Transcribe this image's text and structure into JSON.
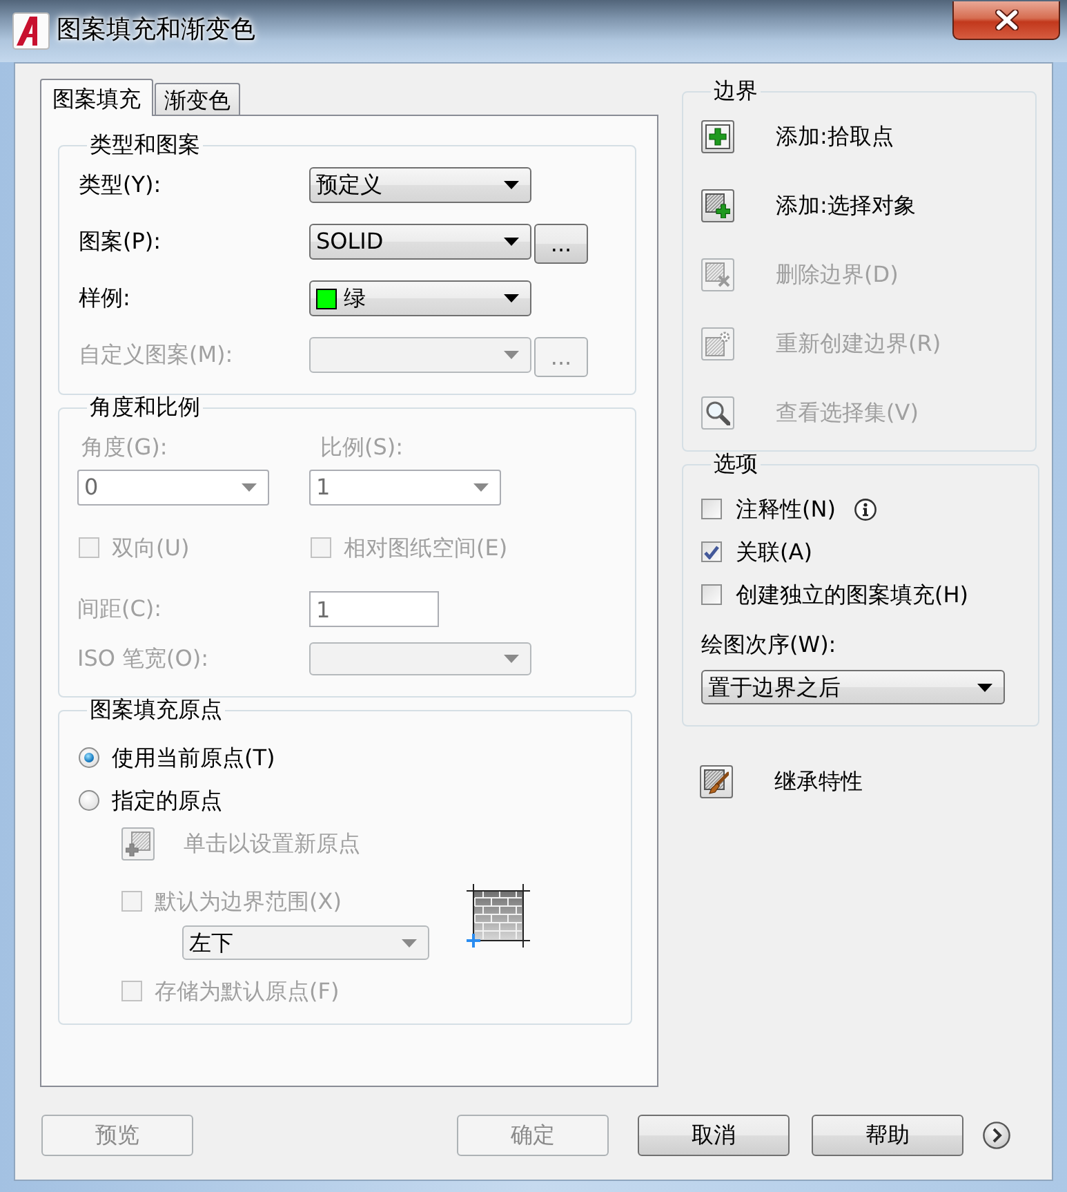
{
  "window": {
    "title": "图案填充和渐变色"
  },
  "tabs": [
    {
      "label": "图案填充",
      "selected": true
    },
    {
      "label": "渐变色",
      "selected": false
    }
  ],
  "type_and_pattern": {
    "title": "类型和图案",
    "fields": [
      {
        "kind": "dropdown",
        "label": "类型(Y):",
        "value": "预定义",
        "disabled": false
      },
      {
        "kind": "dropdown",
        "label": "图案(P):",
        "value": "SOLID",
        "disabled": false,
        "button": "..."
      },
      {
        "kind": "swatch",
        "label": "样例:",
        "value": "绿",
        "color": "#00ff00",
        "disabled": false
      },
      {
        "kind": "dropdown",
        "label": "自定义图案(M):",
        "disabled": true,
        "button": "..."
      }
    ]
  },
  "angle_and_scale": {
    "title": "角度和比例",
    "angle": {
      "label": "角度(G):",
      "value": "0",
      "disabled": true
    },
    "scale": {
      "label": "比例(S):",
      "value": "1",
      "disabled": true
    },
    "checkboxes": [
      {
        "label": "双向(U)",
        "checked": false,
        "disabled": true
      },
      {
        "label": "相对图纸空间(E)",
        "checked": false,
        "disabled": true
      }
    ],
    "spacing": {
      "label": "间距(C):",
      "value": "1",
      "disabled": true
    },
    "iso_pen_width": {
      "label": "ISO 笔宽(O):",
      "disabled": true
    }
  },
  "hatch_origin": {
    "title": "图案填充原点",
    "options": [
      {
        "label": "使用当前原点(T)",
        "selected": true
      },
      {
        "label": "指定的原点",
        "selected": false
      }
    ],
    "set_origin": {
      "label": "单击以设置新原点",
      "disabled": true
    },
    "default_to_boundary": {
      "label": "默认为边界范围(X)",
      "checked": false,
      "disabled": true
    },
    "boundary_position": {
      "value": "左下",
      "disabled": true
    },
    "store_as_default": {
      "label": "存储为默认原点(F)",
      "checked": false,
      "disabled": true
    }
  },
  "boundaries": {
    "title": "边界",
    "actions": [
      {
        "kind": "pick",
        "label": "添加:拾取点",
        "disabled": false
      },
      {
        "kind": "select",
        "label": "添加:选择对象",
        "disabled": false
      },
      {
        "kind": "remove",
        "label": "删除边界(D)",
        "disabled": true
      },
      {
        "kind": "recreate",
        "label": "重新创建边界(R)",
        "disabled": true
      },
      {
        "kind": "view",
        "label": "查看选择集(V)",
        "disabled": true
      }
    ]
  },
  "options": {
    "title": "选项",
    "checkboxes": [
      {
        "label": "注释性(N)",
        "checked": false,
        "info": true
      },
      {
        "label": "关联(A)",
        "checked": true,
        "info": false
      },
      {
        "label": "创建独立的图案填充(H)",
        "checked": false,
        "info": false
      }
    ],
    "draw_order": {
      "label": "绘图次序(W):",
      "value": "置于边界之后"
    }
  },
  "inherit_properties": {
    "label": "继承特性"
  },
  "buttons": [
    {
      "label": "预览",
      "disabled": true
    },
    {
      "label": "确定",
      "disabled": true
    },
    {
      "label": "取消",
      "disabled": false
    },
    {
      "label": "帮助",
      "disabled": false
    }
  ]
}
